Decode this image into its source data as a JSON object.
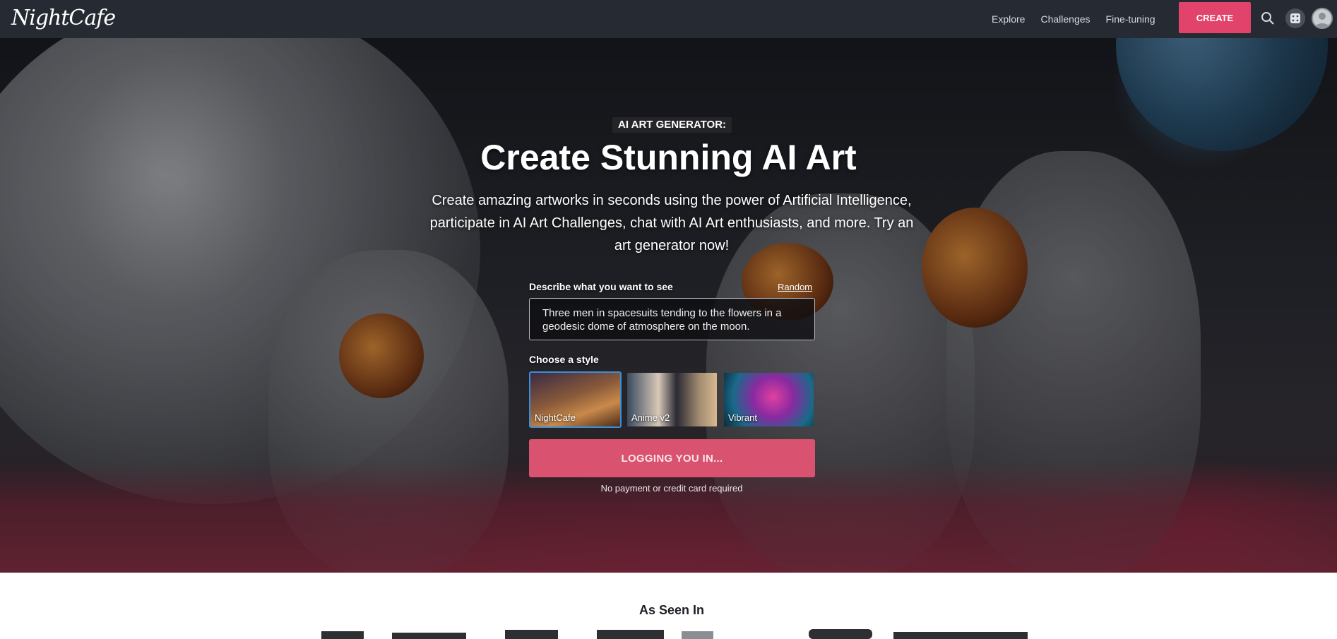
{
  "navbar": {
    "logo": "NightCafe",
    "links": [
      "Explore",
      "Challenges",
      "Fine-tuning"
    ],
    "create_label": "CREATE",
    "icons": [
      "search-icon",
      "dice-icon",
      "avatar"
    ]
  },
  "hero": {
    "badge": "AI ART GENERATOR:",
    "title": "Create Stunning AI Art",
    "subtitle": "Create amazing artworks in seconds using the power of Artificial Intelligence, participate in AI Art Challenges, chat with AI Art enthusiasts, and more. Try an art generator now!",
    "prompt_label": "Describe what you want to see",
    "random_label": "Random",
    "prompt_value": "Three men in spacesuits tending to the flowers in a geodesic dome of atmosphere on the moon.",
    "style_label": "Choose a style",
    "styles": [
      {
        "name": "NightCafe",
        "selected": true
      },
      {
        "name": "Anime v2",
        "selected": false
      },
      {
        "name": "Vibrant",
        "selected": false
      }
    ],
    "login_button": "LOGGING YOU IN...",
    "no_payment": "No payment or credit card required"
  },
  "as_seen_in": {
    "title": "As Seen In"
  },
  "colors": {
    "navbar_bg": "#262b33",
    "accent": "#e2436a",
    "button_disabled": "#d9526f",
    "selected_border": "#3a8fd8"
  }
}
